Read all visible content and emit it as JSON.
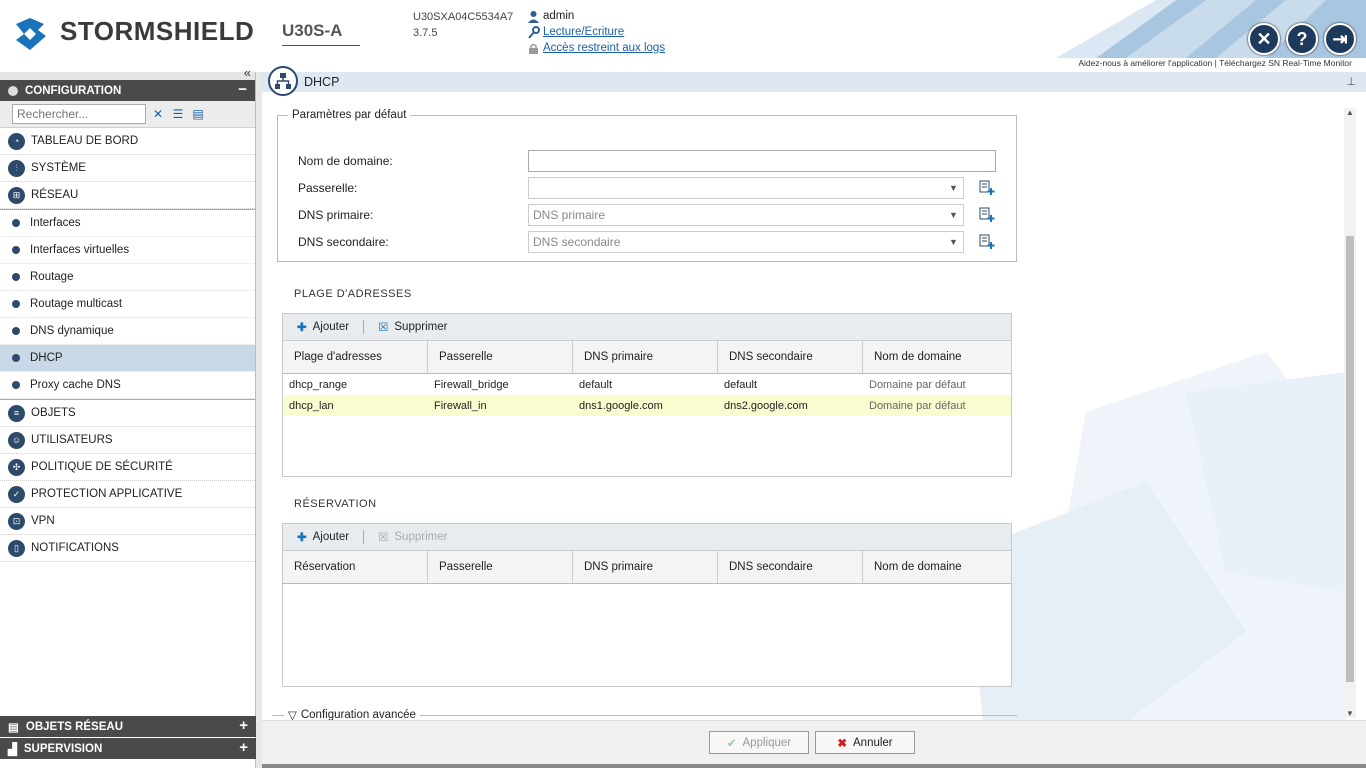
{
  "header": {
    "brand": "STORMSHIELD",
    "model": "U30S-A",
    "serial": "U30SXA04C5534A7",
    "version": "3.7.5",
    "user": "admin",
    "access_mode": "Lecture/Ecriture",
    "logs_access": "Accès restreint aux logs",
    "link_improve": "Aidez-nous à améliorer l'application",
    "link_separator": "|",
    "link_monitor": "Téléchargez SN Real-Time Monitor"
  },
  "sidebar": {
    "config_title": "CONFIGURATION",
    "collapse_symbol": "−",
    "search_placeholder": "Rechercher...",
    "items": [
      {
        "label": "TABLEAU DE BORD"
      },
      {
        "label": "SYSTÈME"
      },
      {
        "label": "RÉSEAU"
      }
    ],
    "subitems": [
      {
        "label": "Interfaces"
      },
      {
        "label": "Interfaces virtuelles"
      },
      {
        "label": "Routage"
      },
      {
        "label": "Routage multicast"
      },
      {
        "label": "DNS dynamique"
      },
      {
        "label": "DHCP"
      },
      {
        "label": "Proxy cache DNS"
      }
    ],
    "items_after": [
      {
        "label": "OBJETS"
      },
      {
        "label": "UTILISATEURS"
      },
      {
        "label": "POLITIQUE DE SÉCURITÉ"
      },
      {
        "label": "PROTECTION APPLICATIVE"
      },
      {
        "label": "VPN"
      },
      {
        "label": "NOTIFICATIONS"
      }
    ],
    "bottom_panels": [
      {
        "label": "OBJETS RÉSEAU",
        "symbol": "+"
      },
      {
        "label": "SUPERVISION",
        "symbol": "+"
      }
    ]
  },
  "main": {
    "title": "DHCP",
    "defaults": {
      "legend": "Paramètres par défaut",
      "domain_label": "Nom de domaine:",
      "domain_value": "",
      "gateway_label": "Passerelle:",
      "gateway_value": "",
      "dns1_label": "DNS primaire:",
      "dns1_value": "DNS primaire",
      "dns2_label": "DNS secondaire:",
      "dns2_value": "DNS secondaire"
    },
    "range": {
      "title": "PLAGE D'ADRESSES",
      "add": "Ajouter",
      "delete": "Supprimer",
      "columns": [
        "Plage d'adresses",
        "Passerelle",
        "DNS primaire",
        "DNS secondaire",
        "Nom de domaine"
      ],
      "rows": [
        [
          "dhcp_range",
          "Firewall_bridge",
          "default",
          "default",
          "Domaine par défaut"
        ],
        [
          "dhcp_lan",
          "Firewall_in",
          "dns1.google.com",
          "dns2.google.com",
          "Domaine par défaut"
        ]
      ]
    },
    "reservation": {
      "title": "RÉSERVATION",
      "add": "Ajouter",
      "delete": "Supprimer",
      "columns": [
        "Réservation",
        "Passerelle",
        "DNS primaire",
        "DNS secondaire",
        "Nom de domaine"
      ]
    },
    "advanced": "Configuration avancée",
    "apply": "Appliquer",
    "cancel": "Annuler"
  }
}
